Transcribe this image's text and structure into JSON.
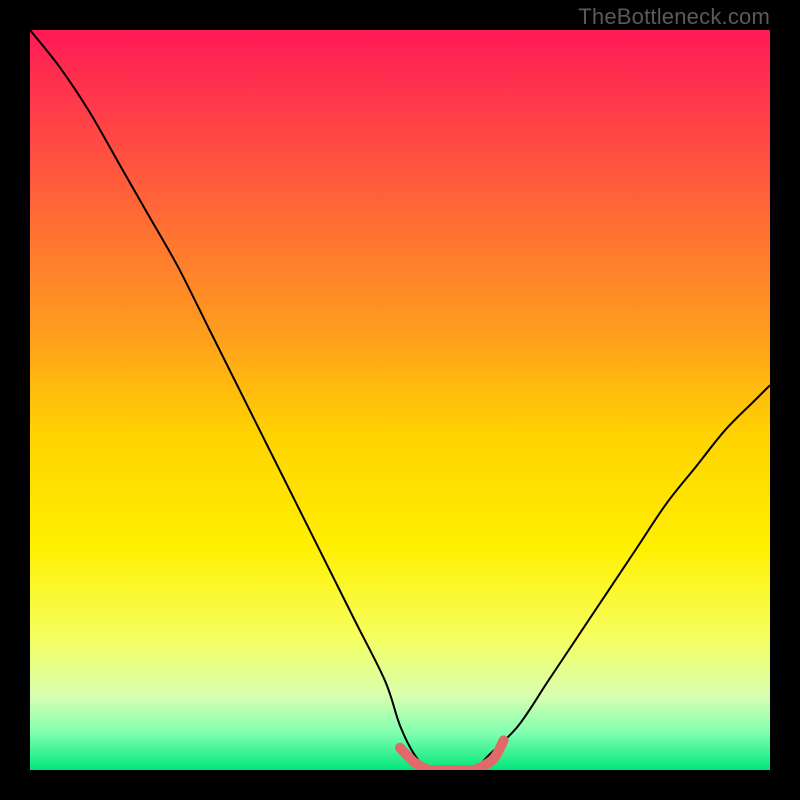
{
  "watermark": "TheBottleneck.com",
  "chart_data": {
    "type": "line",
    "title": "",
    "xlabel": "",
    "ylabel": "",
    "xlim": [
      0,
      100
    ],
    "ylim": [
      0,
      100
    ],
    "gradient_stops": [
      {
        "offset": 0.0,
        "color": "#ff1a55"
      },
      {
        "offset": 0.1,
        "color": "#ff3a4a"
      },
      {
        "offset": 0.25,
        "color": "#ff6a35"
      },
      {
        "offset": 0.4,
        "color": "#ff9a20"
      },
      {
        "offset": 0.55,
        "color": "#ffd400"
      },
      {
        "offset": 0.7,
        "color": "#fff000"
      },
      {
        "offset": 0.82,
        "color": "#f6ff60"
      },
      {
        "offset": 0.9,
        "color": "#d8ffb0"
      },
      {
        "offset": 0.95,
        "color": "#80ffb0"
      },
      {
        "offset": 1.0,
        "color": "#00e67a"
      }
    ],
    "series": [
      {
        "name": "bottleneck-curve",
        "color": "#000000",
        "width": 2,
        "x": [
          0,
          4,
          8,
          12,
          16,
          20,
          24,
          28,
          32,
          36,
          40,
          44,
          48,
          50,
          52,
          54,
          56,
          58,
          60,
          62,
          66,
          70,
          74,
          78,
          82,
          86,
          90,
          94,
          98,
          100
        ],
        "y": [
          100,
          95,
          89,
          82,
          75,
          68,
          60,
          52,
          44,
          36,
          28,
          20,
          12,
          6,
          2,
          0,
          0,
          0,
          0,
          2,
          6,
          12,
          18,
          24,
          30,
          36,
          41,
          46,
          50,
          52
        ]
      },
      {
        "name": "optimal-range-highlight",
        "color": "#e06a6a",
        "width": 10,
        "linecap": "round",
        "x": [
          50,
          52,
          54,
          56,
          58,
          60,
          62,
          63,
          64
        ],
        "y": [
          3,
          1,
          0,
          0,
          0,
          0,
          1,
          2,
          4
        ]
      }
    ]
  }
}
